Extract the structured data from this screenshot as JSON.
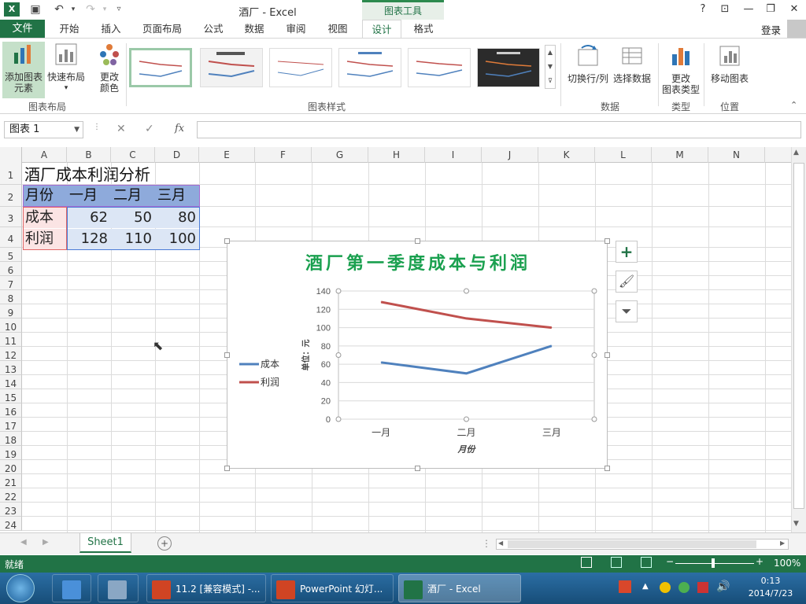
{
  "window": {
    "title": "酒厂 - Excel",
    "context_tab": "图表工具"
  },
  "tabs": {
    "file": "文件",
    "items": [
      "开始",
      "插入",
      "页面布局",
      "公式",
      "数据",
      "审阅",
      "视图",
      "设计",
      "格式"
    ],
    "active": "设计",
    "login": "登录"
  },
  "ribbon": {
    "add_element": [
      "添加图表",
      "元素"
    ],
    "quick_layout": "快速布局",
    "change_color": [
      "更改",
      "颜色"
    ],
    "switch_row_col": "切换行/列",
    "select_data": "选择数据",
    "change_type": [
      "更改",
      "图表类型"
    ],
    "move_chart": "移动图表",
    "groups": {
      "layout": "图表布局",
      "styles": "图表样式",
      "data": "数据",
      "type": "类型",
      "location": "位置"
    }
  },
  "formula_bar": {
    "name_box": "图表 1",
    "fx": "fx",
    "content": ""
  },
  "columns": [
    "A",
    "B",
    "C",
    "D",
    "E",
    "F",
    "G",
    "H",
    "I",
    "J",
    "K",
    "L",
    "M",
    "N"
  ],
  "rows": [
    "1",
    "2",
    "3",
    "4",
    "5",
    "6",
    "7",
    "8",
    "9",
    "10",
    "11",
    "12",
    "13",
    "14",
    "15",
    "16",
    "17",
    "18",
    "19",
    "20",
    "21",
    "22",
    "23",
    "24"
  ],
  "sheet": {
    "title": "酒厂成本利润分析",
    "header": [
      "月份",
      "一月",
      "二月",
      "三月"
    ],
    "rows": [
      {
        "label": "成本",
        "values": [
          "62",
          "50",
          "80"
        ]
      },
      {
        "label": "利润",
        "values": [
          "128",
          "110",
          "100"
        ]
      }
    ]
  },
  "chart_data": {
    "type": "line",
    "title": "酒厂第一季度成本与利润",
    "categories": [
      "一月",
      "二月",
      "三月"
    ],
    "series": [
      {
        "name": "成本",
        "values": [
          62,
          50,
          80
        ],
        "color": "#4f81bd"
      },
      {
        "name": "利润",
        "values": [
          128,
          110,
          100
        ],
        "color": "#c0504d"
      }
    ],
    "xlabel": "月份",
    "ylabel": "单位：元",
    "ylim": [
      0,
      140
    ],
    "yticks": [
      0,
      20,
      40,
      60,
      80,
      100,
      120,
      140
    ],
    "grid": true,
    "legend": "left"
  },
  "sheet_tab": "Sheet1",
  "status": {
    "ready": "就绪",
    "zoom": "100%"
  },
  "taskbar": {
    "items": [
      "11.2 [兼容模式] -...",
      "PowerPoint 幻灯...",
      "酒厂 - Excel"
    ],
    "time": "0:13",
    "date": "2014/7/23"
  },
  "colors": {
    "excel_green": "#217346",
    "header_fill": "#8eaadb",
    "title_green": "#1aa04f"
  }
}
